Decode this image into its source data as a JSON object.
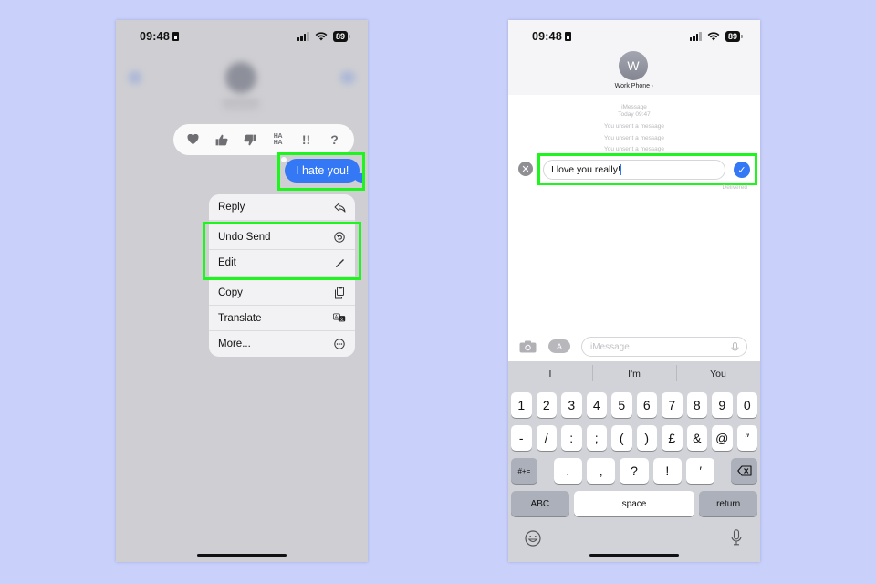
{
  "background_color": "#c9d1fa",
  "highlight_color": "#1ef51e",
  "left_phone": {
    "status": {
      "time": "09:48",
      "battery": "89"
    },
    "reactions": [
      {
        "name": "heart-reaction",
        "glyph": "♥"
      },
      {
        "name": "thumbs-up-reaction",
        "glyph": "👍"
      },
      {
        "name": "thumbs-down-reaction",
        "glyph": "👎"
      },
      {
        "name": "haha-reaction",
        "glyph": "HA HA"
      },
      {
        "name": "exclamation-reaction",
        "glyph": "!!"
      },
      {
        "name": "question-reaction",
        "glyph": "?"
      }
    ],
    "message": {
      "text": "I hate you!",
      "color": "#3478f6"
    },
    "menu": {
      "items": [
        {
          "label": "Reply",
          "icon": "reply-icon"
        },
        {
          "label": "Undo Send",
          "icon": "undo-icon"
        },
        {
          "label": "Edit",
          "icon": "pencil-icon"
        },
        {
          "label": "Copy",
          "icon": "copy-icon"
        },
        {
          "label": "Translate",
          "icon": "translate-icon"
        },
        {
          "label": "More...",
          "icon": "more-icon"
        }
      ]
    }
  },
  "right_phone": {
    "status": {
      "time": "09:48",
      "battery": "89"
    },
    "contact": {
      "initial": "W",
      "name": "Work Phone",
      "chevron": "›"
    },
    "thread": {
      "service": "iMessage",
      "timestamp": "Today 09:47",
      "unsent_notices": [
        "You unsent a message",
        "You unsent a message",
        "You unsent a message"
      ]
    },
    "edit": {
      "value": "I love you really!",
      "cancel_glyph": "✕",
      "confirm_glyph": "✓",
      "status": "Delivered"
    },
    "compose": {
      "placeholder": "iMessage"
    },
    "keyboard": {
      "suggestions": [
        "I",
        "I'm",
        "You"
      ],
      "row1": [
        "1",
        "2",
        "3",
        "4",
        "5",
        "6",
        "7",
        "8",
        "9",
        "0"
      ],
      "row2": [
        "-",
        "/",
        ":",
        ";",
        "(",
        ")",
        "£",
        "&",
        "@",
        "″"
      ],
      "row3_symbols_key": "#+=",
      "row3": [
        ".",
        ",",
        "?",
        "!",
        "′"
      ],
      "abc_key": "ABC",
      "space_key": "space",
      "return_key": "return"
    }
  }
}
